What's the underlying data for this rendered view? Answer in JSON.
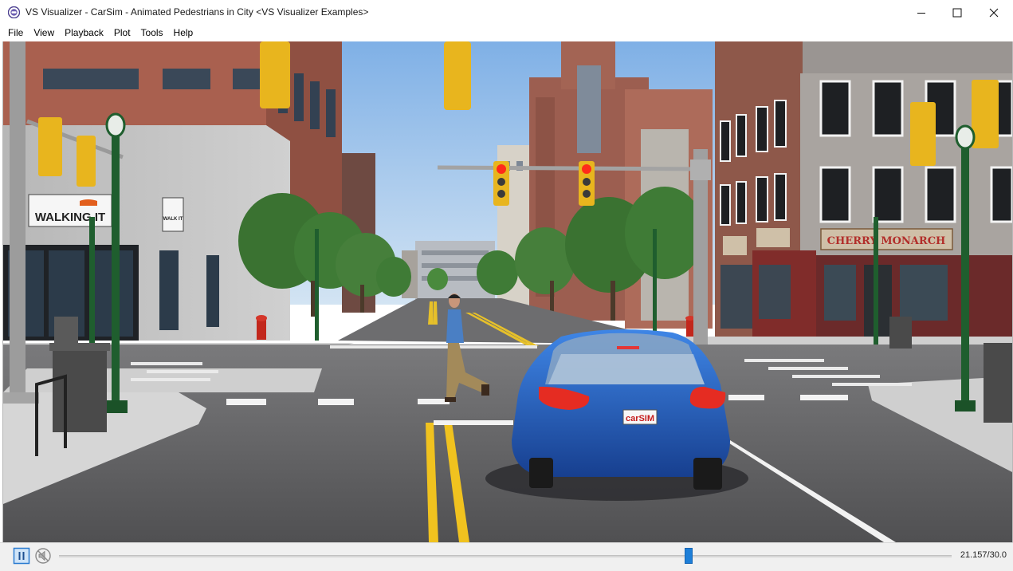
{
  "window": {
    "title": "VS Visualizer - CarSim - Animated Pedestrians in City <VS Visualizer Examples>",
    "app_icon": "vs-visualizer-app-icon",
    "controls": [
      "minimize-icon",
      "maximize-icon",
      "close-icon"
    ]
  },
  "menu": {
    "items": [
      "File",
      "View",
      "Playback",
      "Plot",
      "Tools",
      "Help"
    ]
  },
  "scene": {
    "description_icons": [
      "traffic-light",
      "street-lamp",
      "pedestrian",
      "car",
      "trash-can",
      "fire-hydrant",
      "tree"
    ],
    "signs": {
      "walking_it": "WALKING IT",
      "walk_it_small": "WALK IT",
      "cherry_monarch": "CHERRY MONARCH",
      "carsim_plate": "carSIM"
    },
    "colors": {
      "sky_top": "#8ab8e8",
      "sky_bottom": "#cfe2f4",
      "road": "#5b5b5d",
      "sidewalk": "#c9c9c9",
      "car_body": "#2a62c7",
      "signal_housing": "#e8b51e",
      "signal_red": "#ff2a1a",
      "brick": "#a6604e",
      "tree": "#3e7a34",
      "lamp_post": "#1f5e2e"
    }
  },
  "playback": {
    "pause_icon": "pause-icon",
    "mute_icon": "mute-icon",
    "position_fraction": 0.7052,
    "time_readout": "21.157/30.0"
  }
}
